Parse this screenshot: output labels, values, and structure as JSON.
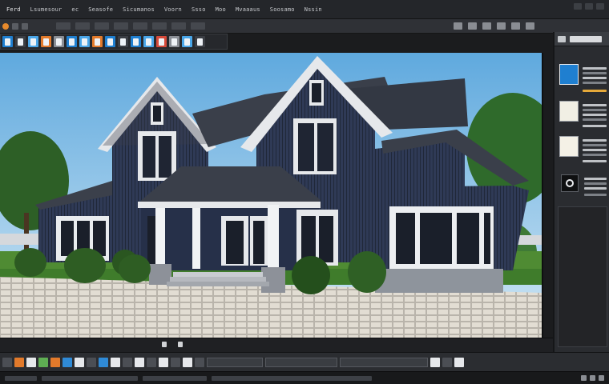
{
  "app": {
    "menu": [
      "Ferd",
      "Lsumesour",
      "ec",
      "Seasofe",
      "Sicumanos",
      "Voorn",
      "Ssso",
      "Moo",
      "Mvaaaus",
      "Soosamo",
      "Nssin"
    ]
  },
  "icons": {
    "menu_bar": [
      "minimize-icon",
      "maximize-icon",
      "close-icon"
    ],
    "tools": [
      "file-icon",
      "page-icon",
      "layers-icon",
      "brush-icon",
      "document-icon",
      "crop-icon",
      "image-icon",
      "text-icon",
      "export-icon",
      "grid-icon",
      "shape-icon",
      "filter-icon",
      "save-icon",
      "settings-icon"
    ],
    "panel": "gear-icon"
  },
  "colors": {
    "accent_orange": "#e27a2b",
    "accent_blue": "#1f7fd0",
    "panel_bg": "#2a2c30",
    "canvas_sky": "#7fc1e8",
    "house_siding": "#2f3a56",
    "roof": "#3a3f4a"
  },
  "canvas": {
    "content": "render"
  }
}
